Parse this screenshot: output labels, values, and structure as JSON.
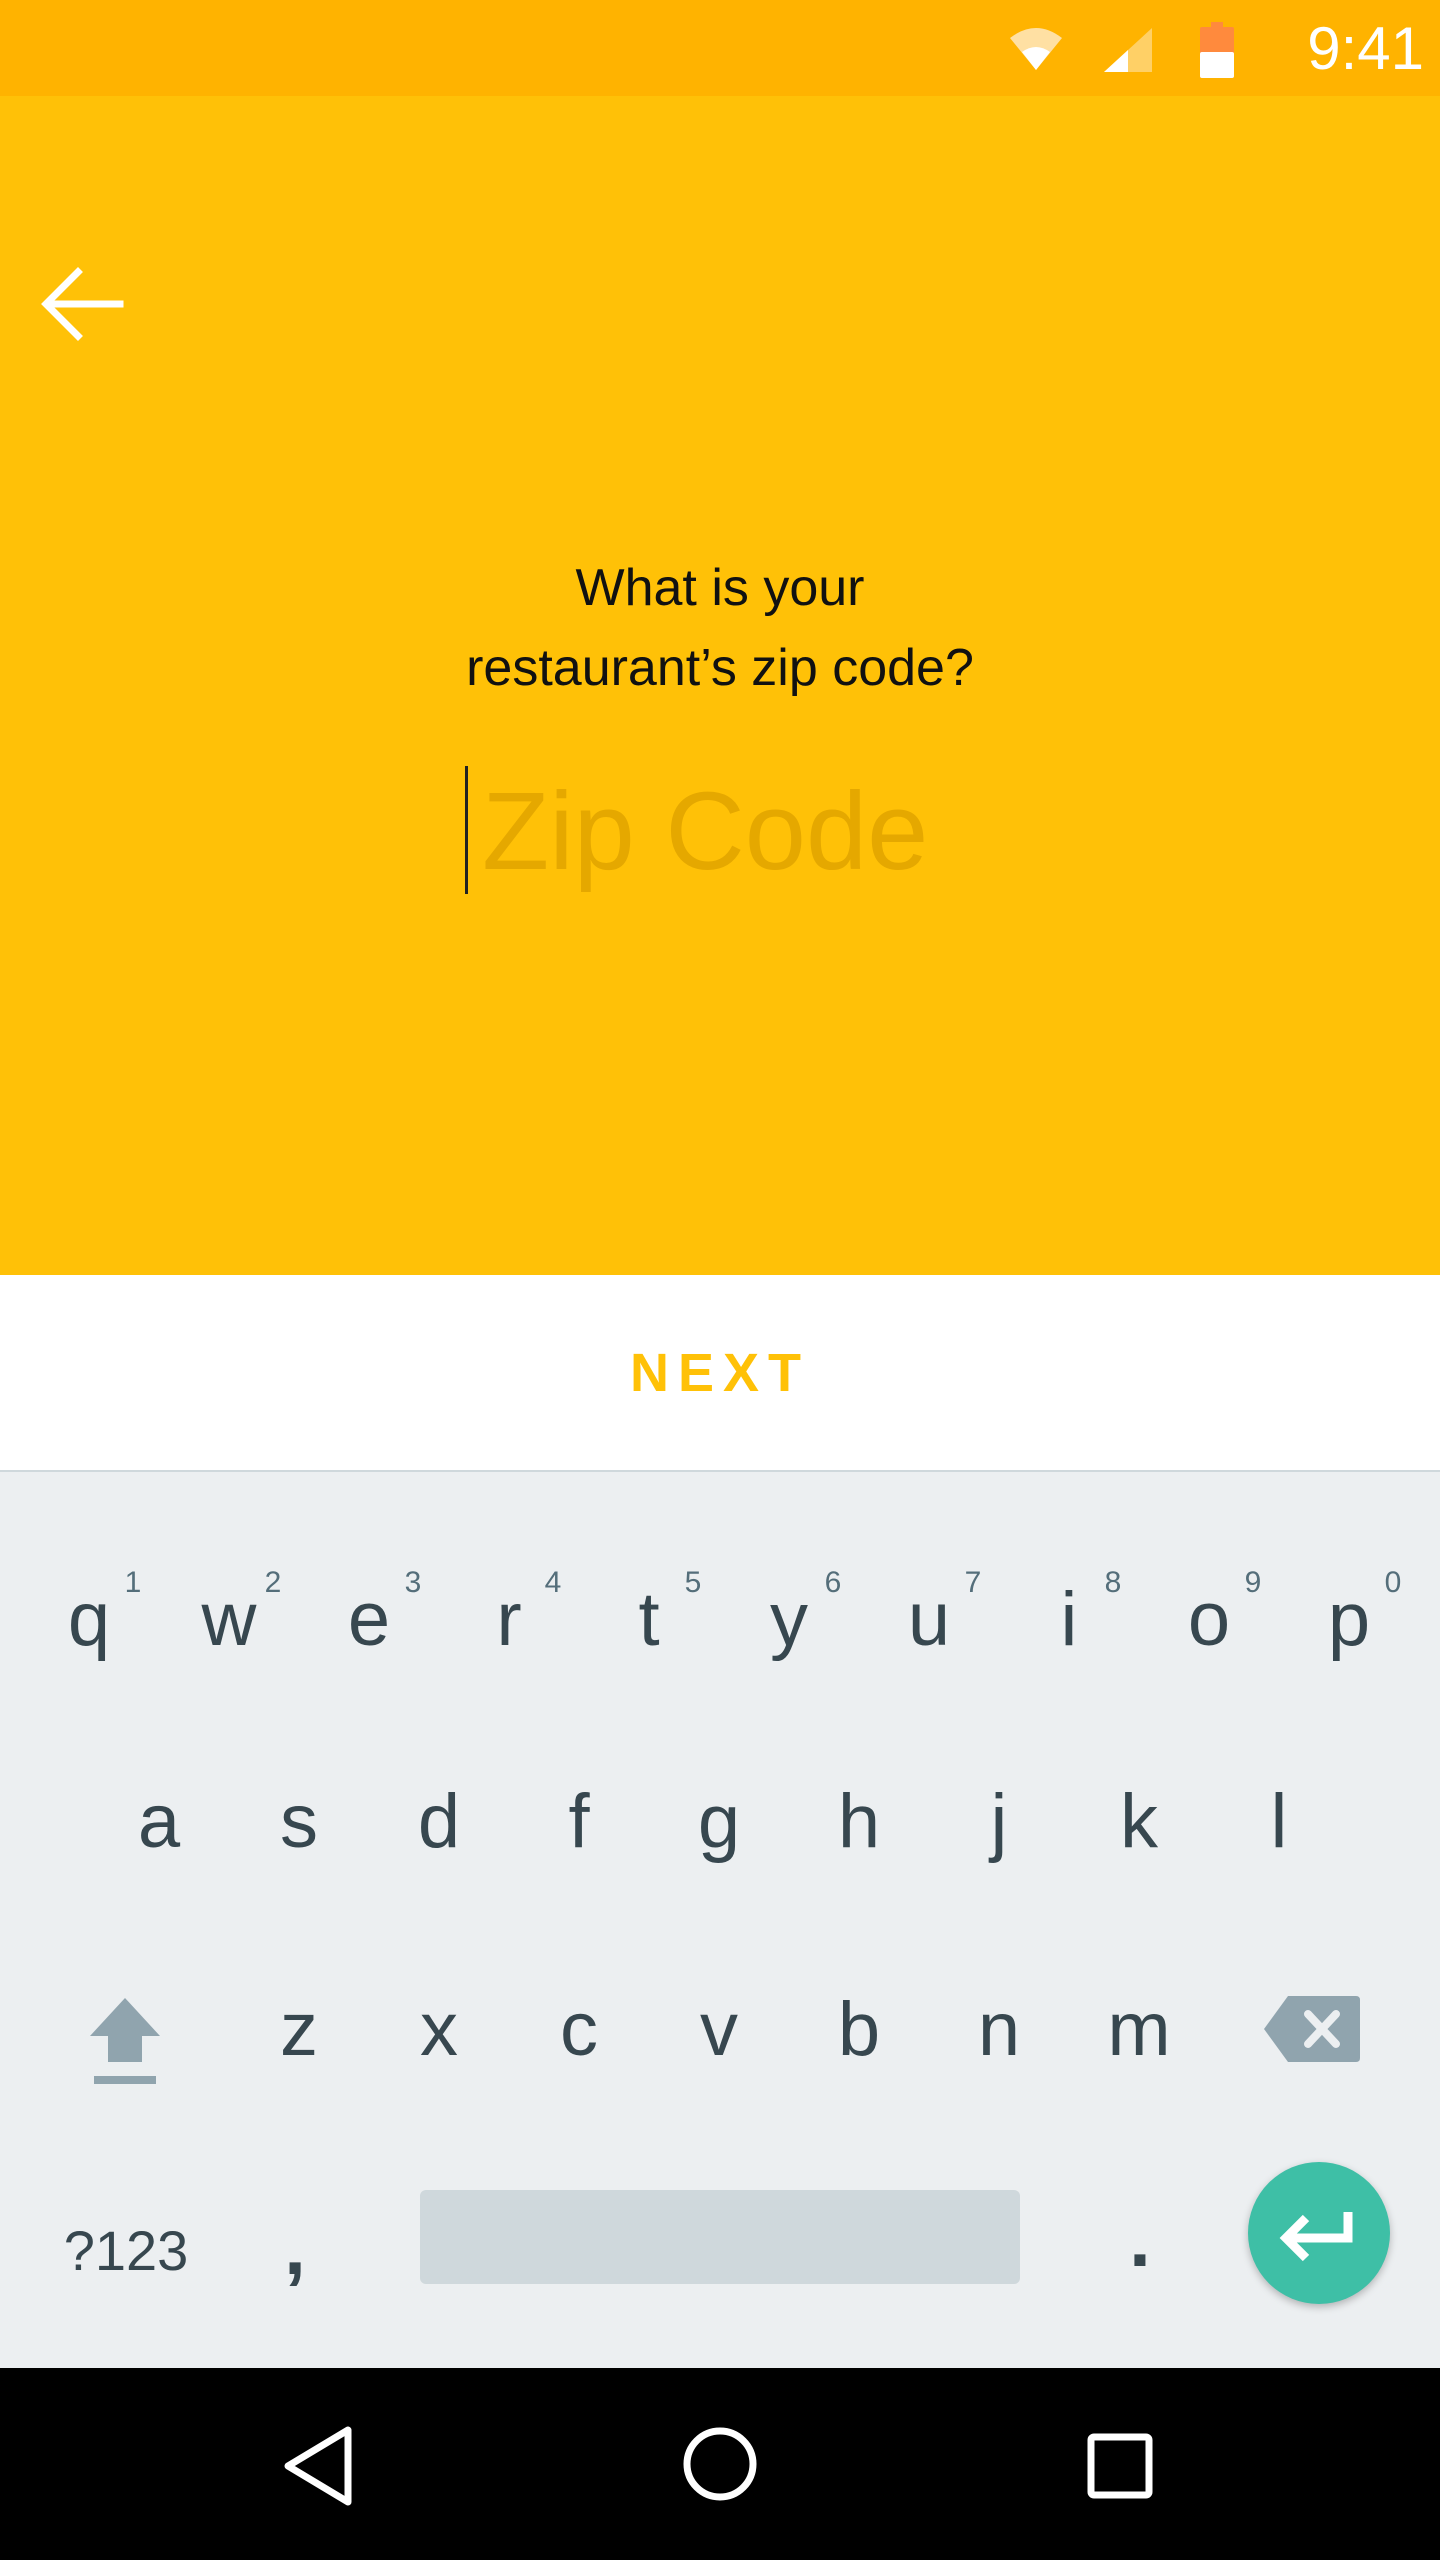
{
  "status_bar": {
    "time": "9:41",
    "icons": [
      "wifi-icon",
      "cell-signal-icon",
      "battery-icon"
    ]
  },
  "header": {
    "back_icon": "arrow-left-icon"
  },
  "main": {
    "question_line1": "What is your",
    "question_line2": "restaurant’s zip code?",
    "zip_input": {
      "placeholder": "Zip Code",
      "value": ""
    }
  },
  "actions": {
    "next_label": "NEXT"
  },
  "keyboard": {
    "row1": [
      {
        "key": "q",
        "hint": "1"
      },
      {
        "key": "w",
        "hint": "2"
      },
      {
        "key": "e",
        "hint": "3"
      },
      {
        "key": "r",
        "hint": "4"
      },
      {
        "key": "t",
        "hint": "5"
      },
      {
        "key": "y",
        "hint": "6"
      },
      {
        "key": "u",
        "hint": "7"
      },
      {
        "key": "i",
        "hint": "8"
      },
      {
        "key": "o",
        "hint": "9"
      },
      {
        "key": "p",
        "hint": "0"
      }
    ],
    "row2": [
      "a",
      "s",
      "d",
      "f",
      "g",
      "h",
      "j",
      "k",
      "l"
    ],
    "row3": [
      "z",
      "x",
      "c",
      "v",
      "b",
      "n",
      "m"
    ],
    "symbols_label": "?123",
    "comma": ",",
    "period": ".",
    "special_icons": [
      "shift-icon",
      "backspace-icon",
      "enter-icon"
    ]
  },
  "colors": {
    "status_bar": "#FFB300",
    "primary": "#FFC107",
    "placeholder": "#E5A800",
    "keyboard_bg": "#ECEFF1",
    "key_text": "#37474F",
    "enter_key": "#3EBFA6"
  },
  "nav_bar": {
    "icons": [
      "nav-back-icon",
      "nav-home-icon",
      "nav-recents-icon"
    ]
  }
}
